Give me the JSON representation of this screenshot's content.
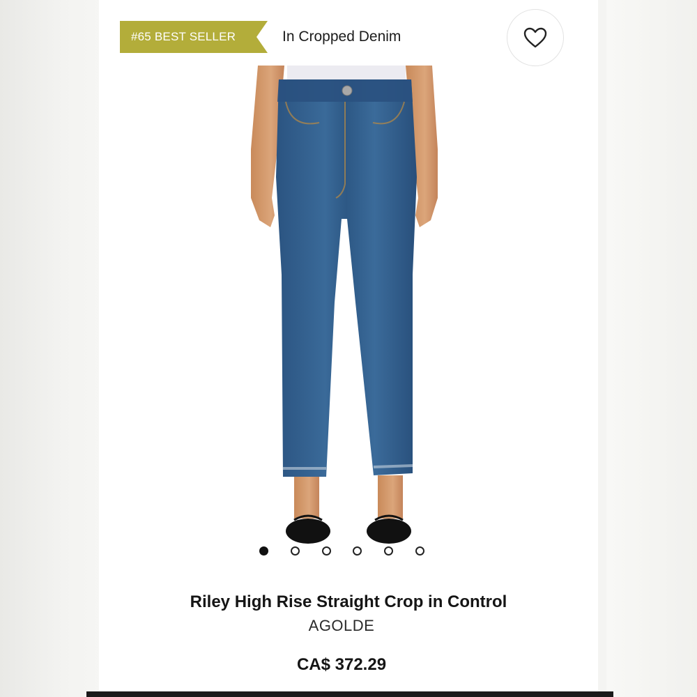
{
  "badge": {
    "label": "#65 BEST SELLER",
    "color": "#b3ad3a"
  },
  "category": "In Cropped Denim",
  "favorite": {
    "icon": "heart-icon"
  },
  "carousel": {
    "total": 6,
    "active_index": 0
  },
  "product": {
    "name": "Riley High Rise Straight Crop in Control",
    "brand": "AGOLDE",
    "price": "CA$ 372.29",
    "denim_color": "#2f5a86"
  }
}
